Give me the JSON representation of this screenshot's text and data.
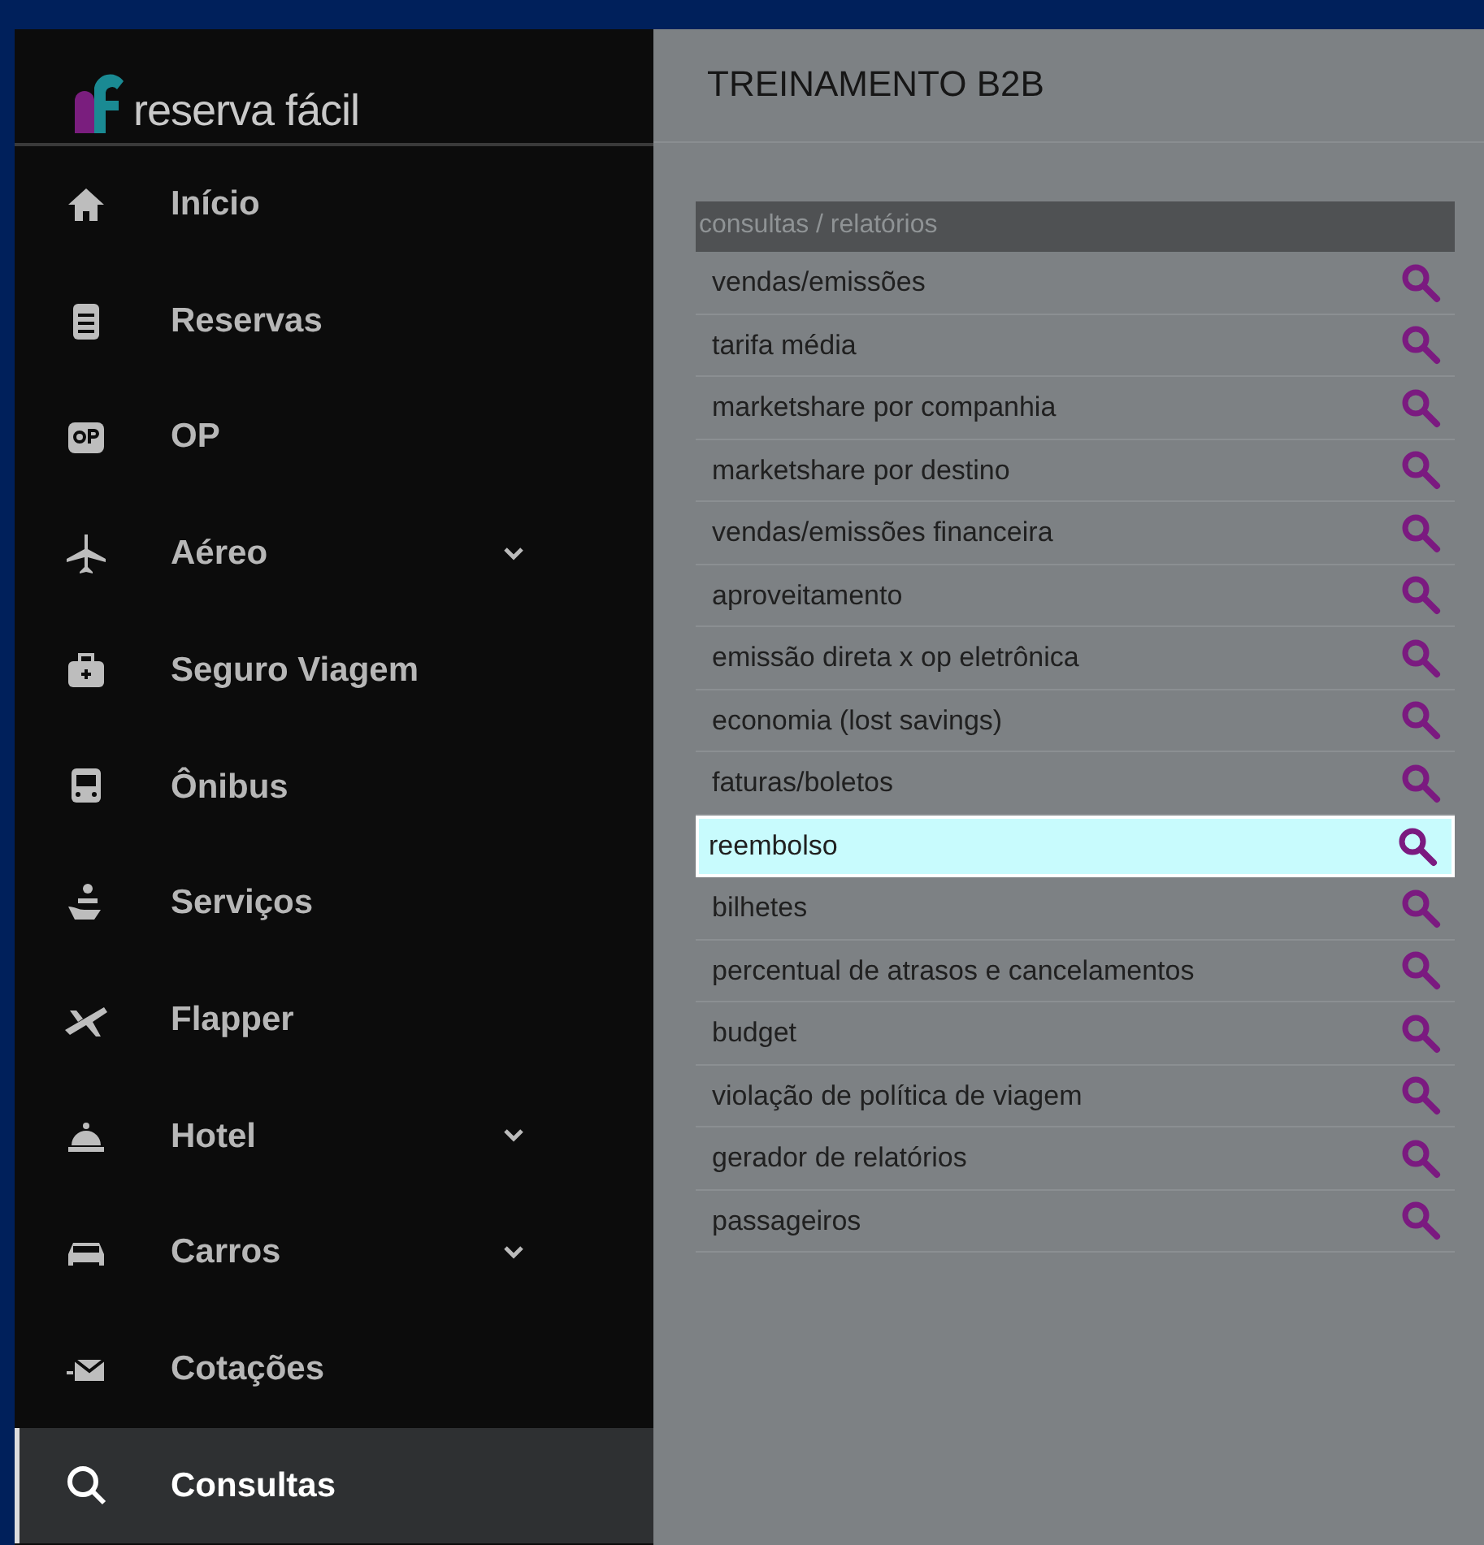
{
  "logo": {
    "text": "reserva fácil"
  },
  "sidebar": {
    "items": [
      {
        "label": "Início",
        "kind": "link",
        "selected": false
      },
      {
        "label": "Reservas",
        "kind": "link",
        "selected": false
      },
      {
        "label": "OP",
        "kind": "link",
        "selected": false
      },
      {
        "label": "Aéreo",
        "kind": "submenu",
        "selected": false
      },
      {
        "label": "Seguro Viagem",
        "kind": "link",
        "selected": false
      },
      {
        "label": "Ônibus",
        "kind": "link",
        "selected": false
      },
      {
        "label": "Serviços",
        "kind": "link",
        "selected": false
      },
      {
        "label": "Flapper",
        "kind": "link",
        "selected": false
      },
      {
        "label": "Hotel",
        "kind": "submenu",
        "selected": false
      },
      {
        "label": "Carros",
        "kind": "submenu",
        "selected": false
      },
      {
        "label": "Cotações",
        "kind": "link",
        "selected": false
      },
      {
        "label": "Consultas",
        "kind": "link",
        "selected": true
      }
    ]
  },
  "page": {
    "title": "TREINAMENTO B2B"
  },
  "reports": {
    "header": "consultas / relatórios",
    "rows": [
      {
        "label": "vendas/emissões",
        "selected": false
      },
      {
        "label": "tarifa média",
        "selected": false
      },
      {
        "label": "marketshare por companhia",
        "selected": false
      },
      {
        "label": "marketshare por destino",
        "selected": false
      },
      {
        "label": "vendas/emissões financeira",
        "selected": false
      },
      {
        "label": "aproveitamento",
        "selected": false
      },
      {
        "label": "emissão direta x op eletrônica",
        "selected": false
      },
      {
        "label": "economia (lost savings)",
        "selected": false
      },
      {
        "label": "faturas/boletos",
        "selected": false
      },
      {
        "label": "reembolso",
        "selected": true
      },
      {
        "label": "bilhetes",
        "selected": false
      },
      {
        "label": "percentual de atrasos e cancelamentos",
        "selected": false
      },
      {
        "label": "budget",
        "selected": false
      },
      {
        "label": "violação de política de viagem",
        "selected": false
      },
      {
        "label": "gerador de relatórios",
        "selected": false
      },
      {
        "label": "passageiros",
        "selected": false
      }
    ]
  }
}
